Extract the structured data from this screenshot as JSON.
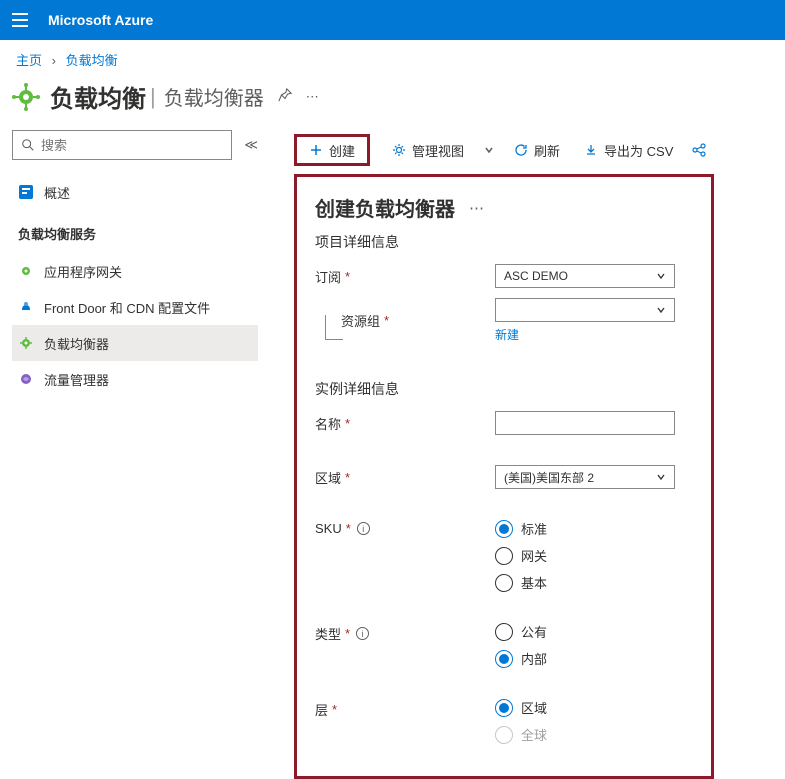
{
  "header": {
    "brand": "Microsoft Azure"
  },
  "breadcrumb": {
    "home": "主页",
    "current": "负载均衡"
  },
  "page_title": {
    "main": "负载均衡",
    "sub": "负载均衡器"
  },
  "sidebar": {
    "search_placeholder": "搜索",
    "overview": "概述",
    "section_label": "负载均衡服务",
    "items": [
      {
        "label": "应用程序网关"
      },
      {
        "label": "Front Door 和 CDN 配置文件"
      },
      {
        "label": "负载均衡器"
      },
      {
        "label": "流量管理器"
      }
    ]
  },
  "toolbar": {
    "create": "创建",
    "manage_view": "管理视图",
    "refresh": "刷新",
    "export_csv": "导出为 CSV"
  },
  "form": {
    "title": "创建负载均衡器",
    "section_project": "项目详细信息",
    "subscription_label": "订阅",
    "subscription_value": "ASC DEMO",
    "resource_group_label": "资源组",
    "resource_group_value": "",
    "new_link": "新建",
    "section_instance": "实例详细信息",
    "name_label": "名称",
    "name_value": "",
    "region_label": "区域",
    "region_value": "(美国)美国东部 2",
    "sku_label": "SKU",
    "sku_options": {
      "standard": "标准",
      "gateway": "网关",
      "basic": "基本"
    },
    "type_label": "类型",
    "type_options": {
      "public": "公有",
      "internal": "内部"
    },
    "tier_label": "层",
    "tier_options": {
      "regional": "区域",
      "global": "全球"
    }
  }
}
